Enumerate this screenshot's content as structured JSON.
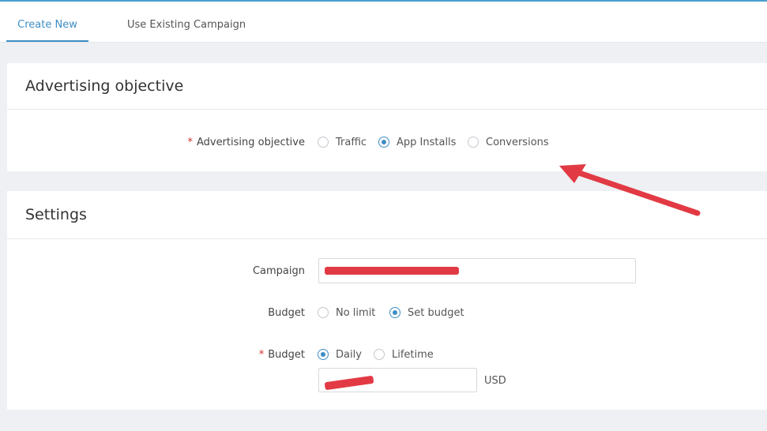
{
  "tabs": {
    "create_new": "Create New",
    "use_existing": "Use Existing Campaign"
  },
  "objective_section": {
    "title": "Advertising objective",
    "field_label": "Advertising objective",
    "required_mark": "*",
    "options": [
      "Traffic",
      "App Installs",
      "Conversions"
    ],
    "selected": "App Installs"
  },
  "settings_section": {
    "title": "Settings",
    "campaign_label": "Campaign",
    "campaign_value": "",
    "budget_label": "Budget",
    "budget_options": [
      "No limit",
      "Set budget"
    ],
    "budget_selected": "Set budget",
    "budget_type_label": "Budget",
    "required_mark": "*",
    "budget_type_options": [
      "Daily",
      "Lifetime"
    ],
    "budget_type_selected": "Daily",
    "amount_value": "",
    "currency": "USD"
  },
  "colors": {
    "accent": "#3d8ec5",
    "required": "#d0332b",
    "annotation_arrow": "#e23a44"
  }
}
